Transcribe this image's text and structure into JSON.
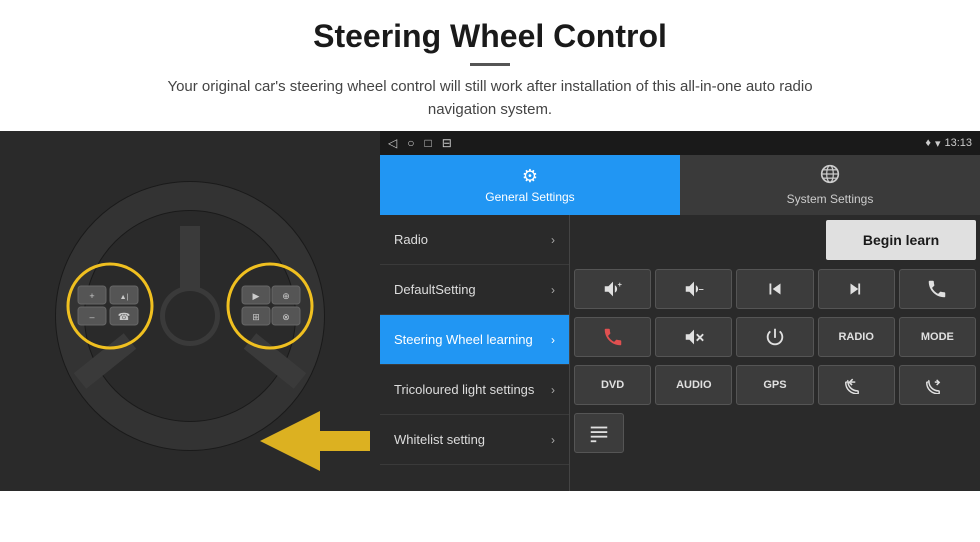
{
  "header": {
    "title": "Steering Wheel Control",
    "subtitle": "Your original car's steering wheel control will still work after installation of this all-in-one auto radio navigation system."
  },
  "status_bar": {
    "time": "13:13",
    "wifi_icon": "▾",
    "signal_icon": "▴"
  },
  "tabs": [
    {
      "label": "General Settings",
      "active": true,
      "icon": "⚙"
    },
    {
      "label": "System Settings",
      "active": false,
      "icon": "🌐"
    }
  ],
  "menu_items": [
    {
      "label": "Radio",
      "active": false
    },
    {
      "label": "DefaultSetting",
      "active": false
    },
    {
      "label": "Steering Wheel learning",
      "active": true
    },
    {
      "label": "Tricoloured light settings",
      "active": false
    },
    {
      "label": "Whitelist setting",
      "active": false
    }
  ],
  "begin_learn_label": "Begin learn",
  "control_buttons": {
    "row1": [
      "vol+",
      "vol-",
      "prev",
      "next",
      "phone"
    ],
    "row2": [
      "call_end",
      "mute",
      "power",
      "RADIO",
      "MODE"
    ],
    "row3": [
      "DVD",
      "AUDIO",
      "GPS",
      "vol+prev",
      "vol-next"
    ],
    "row4": [
      "list"
    ]
  }
}
